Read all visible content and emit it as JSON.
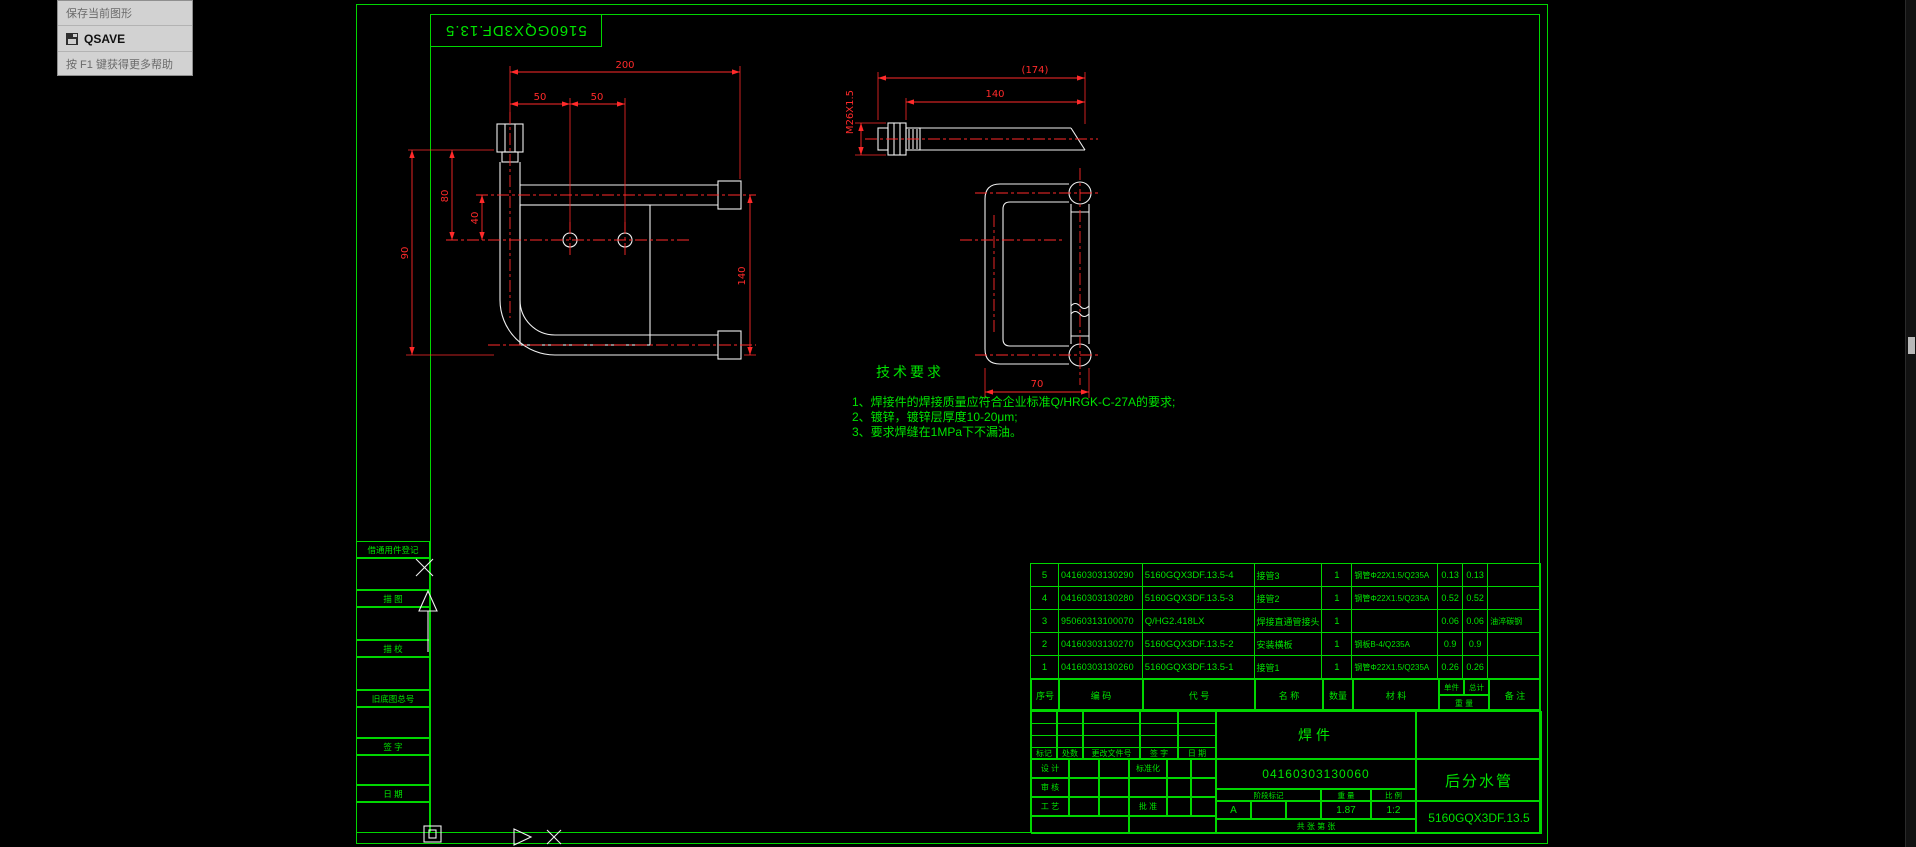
{
  "tooltip": {
    "title": "保存当前图形",
    "command": "QSAVE",
    "help": "按 F1 键获得更多帮助"
  },
  "icons": {
    "qsave_icon": "floppy-disk"
  },
  "sheet_frame": {
    "mirrored_title": "5160GQX3DF.13.5",
    "margin_fields": [
      "借通用件登记",
      "描 图",
      "描 校",
      "旧底图总号",
      "签 字",
      "日 期"
    ]
  },
  "dimensions": {
    "front": [
      "200",
      "50",
      "50",
      "80",
      "40",
      "90",
      "140"
    ],
    "side": [
      "(174)",
      "140",
      "M26X1.5",
      "70"
    ]
  },
  "tech_requirements": {
    "title": "技术要求",
    "items": [
      "1、焊接件的焊接质量应符合企业标准Q/HRGK-C-27A的要求;",
      "2、镀锌，镀锌层厚度10-20μm;",
      "3、要求焊缝在1MPa下不漏油。"
    ]
  },
  "bom": {
    "headers": {
      "no": "序号",
      "code": "编  码",
      "part_no": "代  号",
      "name": "名  称",
      "qty": "数量",
      "material": "材  料",
      "unit": "单件",
      "total": "总计",
      "weight": "重  量",
      "note": "备  注"
    },
    "rows": [
      {
        "no": "5",
        "code": "04160303130290",
        "part_no": "5160GQX3DF.13.5-4",
        "name": "接管3",
        "qty": "1",
        "material": "钢管Φ22X1.5/Q235A",
        "unit": "0.13",
        "total": "0.13",
        "note": ""
      },
      {
        "no": "4",
        "code": "04160303130280",
        "part_no": "5160GQX3DF.13.5-3",
        "name": "接管2",
        "qty": "1",
        "material": "钢管Φ22X1.5/Q235A",
        "unit": "0.52",
        "total": "0.52",
        "note": ""
      },
      {
        "no": "3",
        "code": "95060313100070",
        "part_no": "Q/HG2.418LX",
        "name": "焊接直通管接头",
        "qty": "1",
        "material": "",
        "unit": "0.06",
        "total": "0.06",
        "note": "油淬碳钢"
      },
      {
        "no": "2",
        "code": "04160303130270",
        "part_no": "5160GQX3DF.13.5-2",
        "name": "安装横板",
        "qty": "1",
        "material": "钢板B-4/Q235A",
        "unit": "0.9",
        "total": "0.9",
        "note": ""
      },
      {
        "no": "1",
        "code": "04160303130260",
        "part_no": "5160GQX3DF.13.5-1",
        "name": "接管1",
        "qty": "1",
        "material": "钢管Φ22X1.5/Q235A",
        "unit": "0.26",
        "total": "0.26",
        "note": ""
      }
    ]
  },
  "title_block": {
    "part_type": "焊件",
    "code": "04160303130060",
    "part_name": "后分水管",
    "drawing_no": "5160GQX3DF.13.5",
    "stage_label": "阶段标记",
    "stage_value": "A",
    "weight_label": "重 量",
    "weight_value": "1.87",
    "scale_label": "比 例",
    "scale_value": "1:2",
    "sheet_info": "共  张  第  张",
    "rev_headers": [
      "标记",
      "处数",
      "更改文件号",
      "签 字",
      "日 期"
    ],
    "sign_rows": [
      {
        "left": "设 计",
        "right": "标准化"
      },
      {
        "left": "审 核",
        "right": ""
      },
      {
        "left": "工 艺",
        "right": "批 准"
      }
    ]
  },
  "colors": {
    "frame_green": "#00d600",
    "dim_red": "#ff2a2a",
    "geometry_white": "#f0f0f0"
  }
}
